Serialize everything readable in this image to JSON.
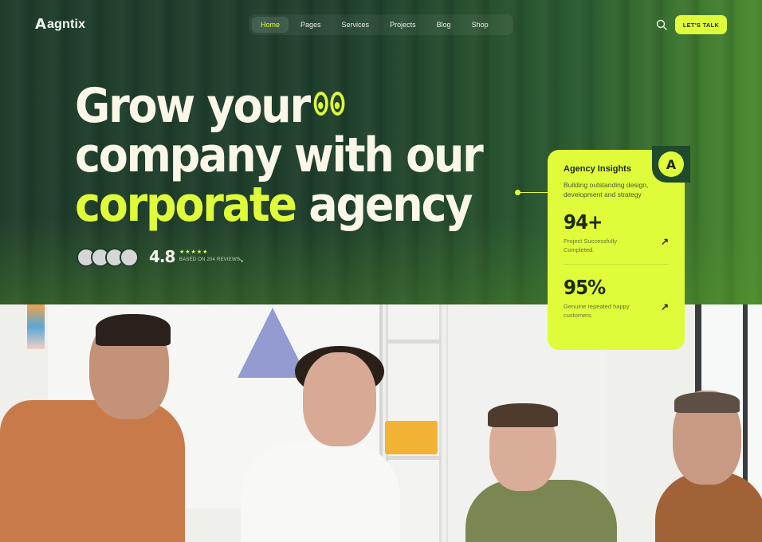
{
  "brand": {
    "logo_mark": "A",
    "name": "agntix"
  },
  "nav": {
    "items": [
      {
        "label": "Home",
        "active": true
      },
      {
        "label": "Pages",
        "active": false
      },
      {
        "label": "Services",
        "active": false
      },
      {
        "label": "Projects",
        "active": false
      },
      {
        "label": "Blog",
        "active": false
      },
      {
        "label": "Shop",
        "active": false
      }
    ],
    "search_icon": "search-icon",
    "cta_label": "LET'S TALK"
  },
  "hero": {
    "line1": "Grow your",
    "line2": "company with our",
    "line3_accent": "corporate",
    "line3_rest": " agency",
    "rating_value": "4.8",
    "stars": "★★★★★",
    "reviews_text": "BASED ON 204 REVIEWS",
    "avatar_count": 4
  },
  "insights_card": {
    "title": "Agency Insights",
    "description": "Building outstanding design, development and strategy",
    "stats": [
      {
        "value": "94+",
        "label": "Project Successfully Completed."
      },
      {
        "value": "95%",
        "label": "Genuine repeated happy customers."
      }
    ]
  },
  "colors": {
    "accent": "#dffb3a",
    "hero_dark": "#1f3d2b",
    "headline_text": "#fbf7e8"
  }
}
